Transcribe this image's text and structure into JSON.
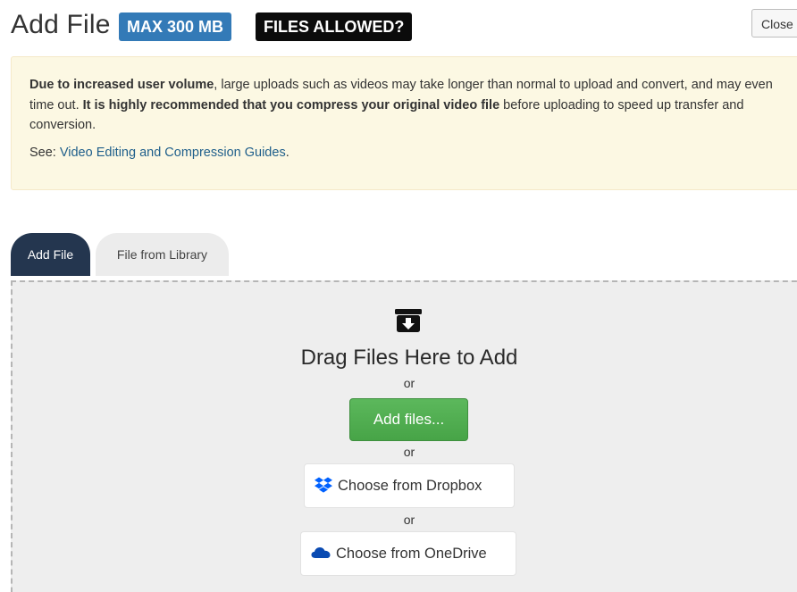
{
  "header": {
    "title": "Add File",
    "max_badge": "MAX 300 MB",
    "allowed_badge": "FILES ALLOWED?",
    "close_label": "Close"
  },
  "warning": {
    "p1_bold1": "Due to increased user volume",
    "p1_text1": ", large uploads such as videos may take longer than normal to upload and convert, and may even time out. ",
    "p1_bold2": "It is highly recommended that you compress your original video file",
    "p1_text2": " before uploading to speed up transfer and conversion.",
    "p2_prefix": "See: ",
    "p2_link": "Video Editing and Compression Guides",
    "p2_suffix": "."
  },
  "tabs": {
    "add_file": "Add File",
    "library": "File from Library"
  },
  "dropzone": {
    "drag_text": "Drag Files Here to Add",
    "or1": "or",
    "add_files": "Add files...",
    "or2": "or",
    "dropbox": "Choose from Dropbox",
    "or3": "or",
    "onedrive": "Choose from OneDrive"
  },
  "colors": {
    "max_badge": "#337ab7",
    "allowed_badge": "#0b0b0b",
    "warning_bg": "#fcf8e3",
    "link": "#1f5f8b",
    "active_tab": "#24364f",
    "add_files": "#5cb85c",
    "dropbox_icon": "#0061ff",
    "onedrive_icon": "#094ab2"
  }
}
